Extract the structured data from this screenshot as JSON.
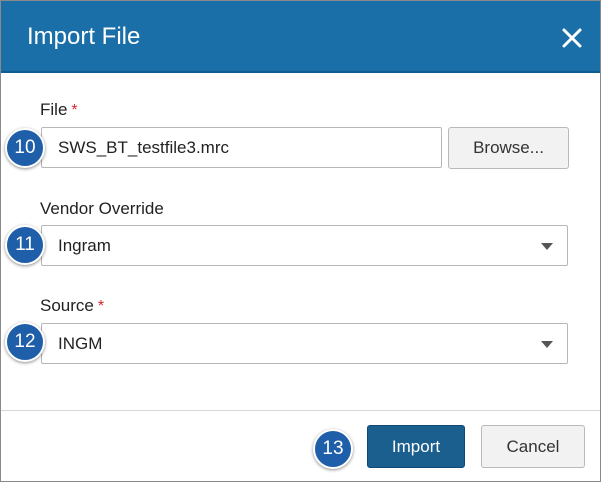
{
  "dialog": {
    "title": "Import File",
    "close_icon": "close-icon"
  },
  "file": {
    "label": "File",
    "required_mark": "*",
    "value": "SWS_BT_testfile3.mrc",
    "browse_label": "Browse..."
  },
  "vendor_override": {
    "label": "Vendor Override",
    "selected": "Ingram"
  },
  "source": {
    "label": "Source",
    "required_mark": "*",
    "selected": "INGM"
  },
  "footer": {
    "import_label": "Import",
    "cancel_label": "Cancel"
  },
  "callouts": [
    "10",
    "11",
    "12",
    "13"
  ],
  "colors": {
    "header": "#1b6fa8",
    "primary_button": "#1a5f8e",
    "callout": "#1f5ea8",
    "required": "#d9262f"
  }
}
